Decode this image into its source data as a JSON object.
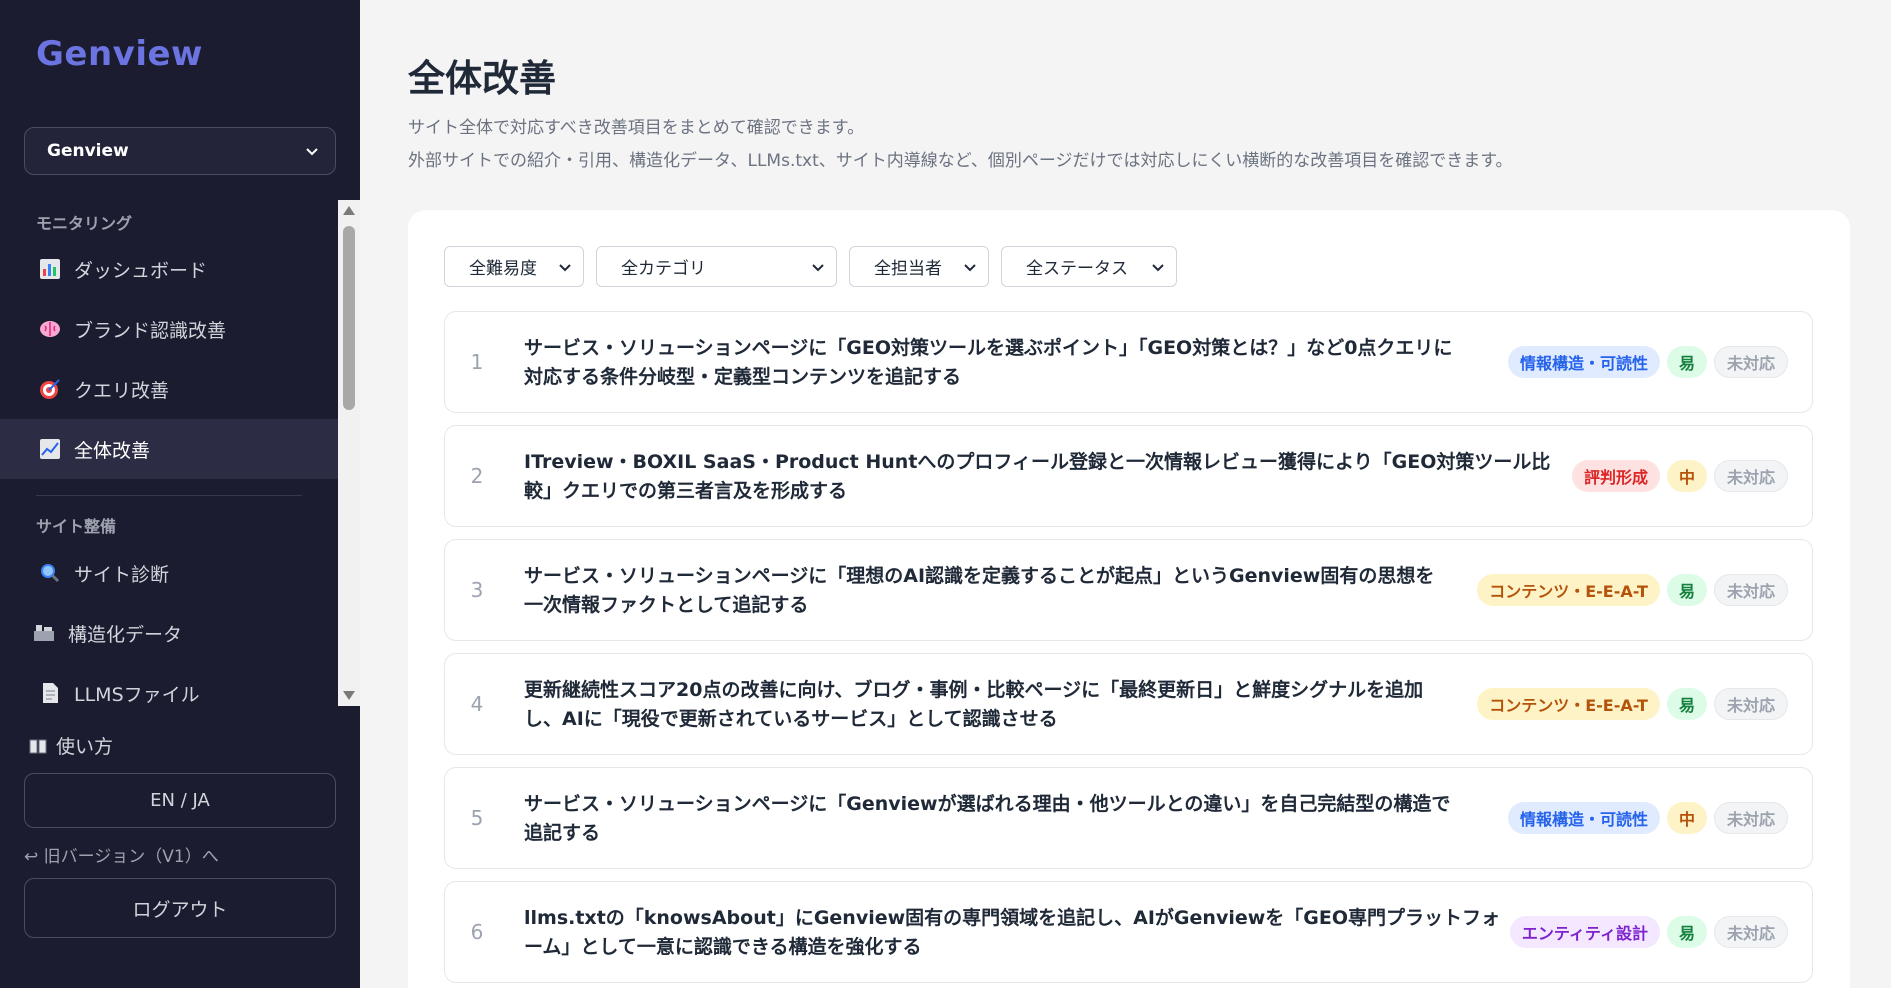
{
  "sidebar": {
    "logo": "Genview",
    "workspace": "Genview",
    "sections": [
      {
        "label": "モニタリング"
      },
      {
        "label": "サイト整備"
      }
    ],
    "items": [
      {
        "label": "ダッシュボード",
        "icon": "bar-chart-icon"
      },
      {
        "label": "ブランド認識改善",
        "icon": "brain-icon"
      },
      {
        "label": "クエリ改善",
        "icon": "target-icon"
      },
      {
        "label": "全体改善",
        "icon": "trend-chart-icon"
      },
      {
        "label": "サイト診断",
        "icon": "magnifier-icon"
      },
      {
        "label": "構造化データ",
        "icon": "structure-icon"
      },
      {
        "label": "LLMSファイル",
        "icon": "document-icon"
      }
    ],
    "howto": "使い方",
    "lang": "EN / JA",
    "old_version": "↩ 旧バージョン（V1）へ",
    "logout": "ログアウト"
  },
  "main": {
    "title": "全体改善",
    "desc1": "サイト全体で対応すべき改善項目をまとめて確認できます。",
    "desc2": "外部サイトでの紹介・引用、構造化データ、LLMs.txt、サイト内導線など、個別ページだけでは対応しにくい横断的な改善項目を確認できます。",
    "filters": [
      "全難易度",
      "全カテゴリ",
      "全担当者",
      "全ステータス"
    ],
    "items": [
      {
        "num": "1",
        "line1": "サービス・ソリューションページに「GEO対策ツールを選ぶポイント」「GEO対策とは？」など0点クエリに",
        "line2": "対応する条件分岐型・定義型コンテンツを追記する",
        "category": "情報構造・可読性",
        "difficulty": "易",
        "status": "未対応"
      },
      {
        "num": "2",
        "line1": "ITreview・BOXIL SaaS・Product Huntへのプロフィール登録と一次情報レビュー獲得により「GEO対策ツール比",
        "line2": "較」クエリでの第三者言及を形成する",
        "category": "評判形成",
        "difficulty": "中",
        "status": "未対応"
      },
      {
        "num": "3",
        "line1": "サービス・ソリューションページに「理想のAI認識を定義することが起点」というGenview固有の思想を",
        "line2": "一次情報ファクトとして追記する",
        "category": "コンテンツ・E-E-A-T",
        "difficulty": "易",
        "status": "未対応"
      },
      {
        "num": "4",
        "line1": "更新継続性スコア20点の改善に向け、ブログ・事例・比較ページに「最終更新日」と鮮度シグナルを追加",
        "line2": "し、AIに「現役で更新されているサービス」として認識させる",
        "category": "コンテンツ・E-E-A-T",
        "difficulty": "易",
        "status": "未対応"
      },
      {
        "num": "5",
        "line1": "サービス・ソリューションページに「Genviewが選ばれる理由・他ツールとの違い」を自己完結型の構造で",
        "line2": "追記する",
        "category": "情報構造・可読性",
        "difficulty": "中",
        "status": "未対応"
      },
      {
        "num": "6",
        "line1": "llms.txtの「knowsAbout」にGenview固有の専門領域を追記し、AIがGenviewを「GEO専門プラットフォ",
        "line2": "ーム」として一意に認識できる構造を強化する",
        "category": "エンティティ設計",
        "difficulty": "易",
        "status": "未対応"
      }
    ]
  },
  "colors": {
    "sidebar_bg": "#1c1c30",
    "logo": "#6b74e0",
    "cat_info": "#2563eb",
    "cat_reputation": "#dc2626",
    "cat_content": "#b45309",
    "cat_entity": "#7e22ce",
    "diff_easy": "#15803d",
    "diff_mid": "#b45309"
  }
}
